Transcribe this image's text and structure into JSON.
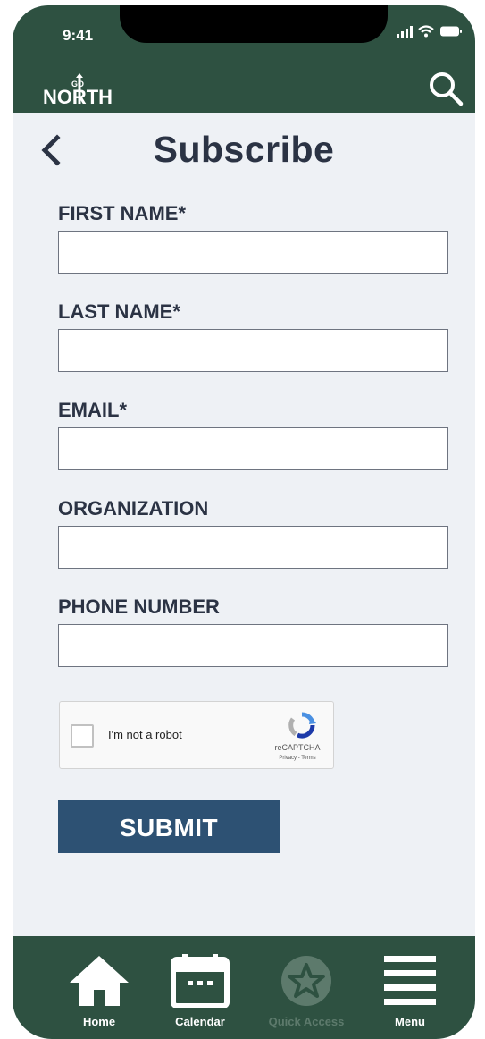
{
  "status_bar": {
    "time": "9:41"
  },
  "header": {
    "logo_top": "GO",
    "logo_main": "NORTH",
    "search_icon": "search-icon"
  },
  "page": {
    "title": "Subscribe",
    "back_icon": "chevron-left-icon"
  },
  "form": {
    "fields": [
      {
        "label": "FIRST NAME*",
        "value": ""
      },
      {
        "label": "LAST NAME*",
        "value": ""
      },
      {
        "label": "EMAIL*",
        "value": ""
      },
      {
        "label": "ORGANIZATION",
        "value": ""
      },
      {
        "label": "PHONE NUMBER",
        "value": ""
      }
    ],
    "captcha": {
      "label": "I'm not a robot",
      "brand": "reCAPTCHA",
      "links": "Privacy - Terms"
    },
    "submit_label": "SUBMIT"
  },
  "bottom_nav": {
    "items": [
      {
        "label": "Home",
        "icon": "home-icon"
      },
      {
        "label": "Calendar",
        "icon": "calendar-icon"
      },
      {
        "label": "Quick Access",
        "icon": "star-icon",
        "disabled": true
      },
      {
        "label": "Menu",
        "icon": "menu-icon"
      }
    ]
  },
  "colors": {
    "header_green": "#2e5141",
    "page_bg": "#eef1f5",
    "submit_blue": "#2d5173",
    "title_text": "#2b3344"
  }
}
